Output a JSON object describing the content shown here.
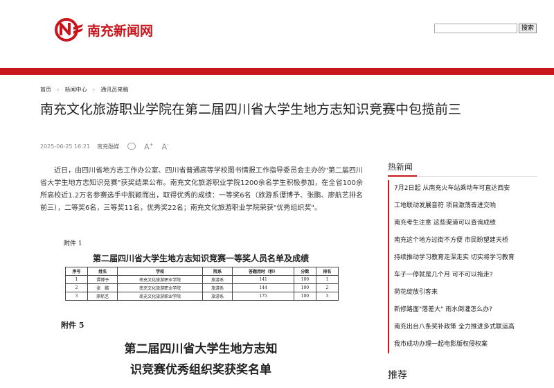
{
  "header": {
    "logo_text": "南充新闻网",
    "search_button": "搜索",
    "search_value": ""
  },
  "breadcrumb": [
    "首页",
    "新闻中心",
    "通讯员来稿"
  ],
  "article": {
    "title": "南充文化旅游职业学院在第二届四川省大学生地方志知识竞赛中包揽前三",
    "date": "2025-06-25 16:21",
    "source": "南充融媒",
    "font_larger": "A",
    "font_smaller": "A",
    "body": "近日，由四川省地方志工作办公室、四川省普通高等学校图书情报工作指导委员会主办的\"第二届四川省大学生地方志知识竞赛\"获奖结果公布。南充文化旅游职业学院1200余名学生积极参加，在全省100余所高校近1.2万名参赛选手中脱颖而出，取得优秀的成绩：一等奖6名（旅游系谭博予、张鹏、廖航艺排名前三），二等奖6名，三等奖11名，优秀奖22名；南充文化旅游职业学院荣获\"优秀组织奖\"。"
  },
  "figure": {
    "attach1": "附件 1",
    "table_title": "第二届四川省大学生地方志知识竞赛一等奖人员名单及成绩",
    "headers": [
      "序号",
      "姓名",
      "学校",
      "院系",
      "答题用时（秒）",
      "分数",
      "排名"
    ],
    "rows": [
      [
        "1",
        "谭博予",
        "南充文化旅游职业学院",
        "旅游系",
        "141",
        "100",
        "1"
      ],
      [
        "2",
        "张　鹏",
        "南充文化旅游职业学院",
        "旅游系",
        "144",
        "100",
        "2"
      ],
      [
        "3",
        "廖航艺",
        "南充文化旅游职业学院",
        "旅游系",
        "175",
        "100",
        "3"
      ]
    ],
    "attach5": "附件 5",
    "big_title_line1": "第二届四川省大学生地方志知",
    "big_title_line2": "识竞赛优秀组织奖获奖名单"
  },
  "sidebar": {
    "hot_title": "热新闻",
    "hot_items": [
      "7月2日起 从南充火车站乘动车可直达西安",
      "工地联动发展音符 项目激荡奋进交响",
      "南充考生注意 这些渠道可以查询成绩",
      "南充这个地方过街不方便 市民盼望建天桥",
      "持续推动学习教育走深走实 切实将学习教育",
      "车子一停就是几个月 可不可以拖走?",
      "荷花绽放引客来",
      "新修路面\"落差大\" 雨水倒灌怎么办?",
      "南充出台八条奖补政策 全力推进多式联运高",
      "我市成功办理一起电影版权侵权案"
    ],
    "recommend_title": "推荐"
  },
  "colors": {
    "brand_red": "#c8161d"
  }
}
